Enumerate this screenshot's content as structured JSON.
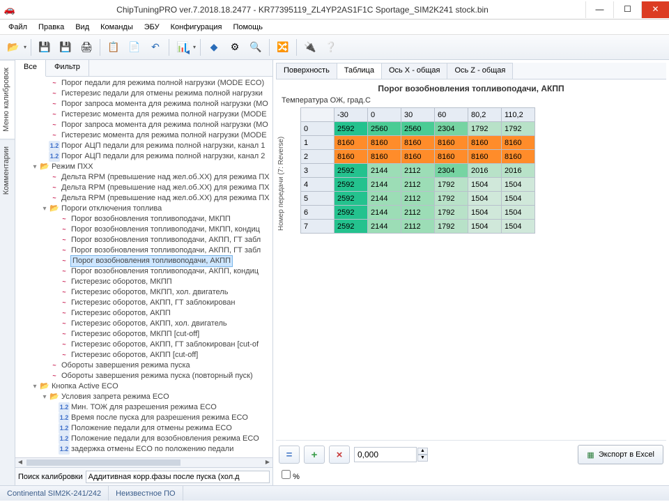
{
  "title": "ChipTuningPRO ver.7.2018.18.2477 - KR77395119_ZL4YP2AS1F1C Sportage_SIM2K241 stock.bin",
  "menu": [
    "Файл",
    "Правка",
    "Вид",
    "Команды",
    "ЭБУ",
    "Конфигурация",
    "Помощь"
  ],
  "vtabs": [
    "Меню калибровок",
    "Комментарии"
  ],
  "lefttabs": [
    "Все",
    "Фильтр"
  ],
  "tree": [
    {
      "d": 2,
      "t": "chart",
      "l": "Порог педали для режима полной нагрузки (MODE ECO)"
    },
    {
      "d": 2,
      "t": "chart",
      "l": "Гистерезис педали для отмены режима полной нагрузки"
    },
    {
      "d": 2,
      "t": "chart",
      "l": "Порог запроса момента для режима полной нагрузки (МО"
    },
    {
      "d": 2,
      "t": "chart",
      "l": "Гистерезис момента для режима полной нагрузки (MODE"
    },
    {
      "d": 2,
      "t": "chart",
      "l": "Порог запроса момента для режима полной нагрузки (МО"
    },
    {
      "d": 2,
      "t": "chart",
      "l": "Гистерезис момента для режима полной нагрузки (MODE"
    },
    {
      "d": 2,
      "t": "scalar",
      "l": "Порог АЦП педали для режима полной нагрузки, канал 1"
    },
    {
      "d": 2,
      "t": "scalar",
      "l": "Порог АЦП педали для режима полной нагрузки, канал 2"
    },
    {
      "d": 1,
      "t": "folder",
      "e": "▾",
      "l": "Режим ПХХ"
    },
    {
      "d": 2,
      "t": "chart",
      "l": "Дельта RPM (превышение над жел.об.ХХ) для режима ПХ"
    },
    {
      "d": 2,
      "t": "chart",
      "l": "Дельта RPM (превышение над жел.об.ХХ) для режима ПХ"
    },
    {
      "d": 2,
      "t": "chart",
      "l": "Дельта RPM (превышение над жел.об.ХХ) для режима ПХ"
    },
    {
      "d": 2,
      "t": "folder",
      "e": "▾",
      "l": "Пороги отключения топлива"
    },
    {
      "d": 3,
      "t": "chart",
      "l": "Порог возобновления топливоподачи, МКПП"
    },
    {
      "d": 3,
      "t": "chart",
      "l": "Порог возобновления топливоподачи, МКПП, кондиц"
    },
    {
      "d": 3,
      "t": "chart",
      "l": "Порог возобновления топливоподачи, АКПП, ГТ забл"
    },
    {
      "d": 3,
      "t": "chart",
      "l": "Порог возобновления топливоподачи, АКПП, ГТ забл"
    },
    {
      "d": 3,
      "t": "chart",
      "l": "Порог возобновления топливоподачи, АКПП",
      "sel": true
    },
    {
      "d": 3,
      "t": "chart",
      "l": "Порог возобновления топливоподачи, АКПП, кондиц"
    },
    {
      "d": 3,
      "t": "chart",
      "l": "Гистерезис оборотов, МКПП"
    },
    {
      "d": 3,
      "t": "chart",
      "l": "Гистерезис оборотов, МКПП, хол. двигатель"
    },
    {
      "d": 3,
      "t": "chart",
      "l": "Гистерезис оборотов, АКПП, ГТ заблокирован"
    },
    {
      "d": 3,
      "t": "chart",
      "l": "Гистерезис оборотов, АКПП"
    },
    {
      "d": 3,
      "t": "chart",
      "l": "Гистерезис оборотов, АКПП, хол. двигатель"
    },
    {
      "d": 3,
      "t": "chart",
      "l": "Гистерезис оборотов, МКПП [cut-off]"
    },
    {
      "d": 3,
      "t": "chart",
      "l": "Гистерезис оборотов, АКПП, ГТ заблокирован [cut-of"
    },
    {
      "d": 3,
      "t": "chart",
      "l": "Гистерезис оборотов, АКПП [cut-off]"
    },
    {
      "d": 2,
      "t": "chart",
      "l": "Обороты завершения режима пуска"
    },
    {
      "d": 2,
      "t": "chart",
      "l": "Обороты завершения режима пуска (повторный пуск)"
    },
    {
      "d": 1,
      "t": "folder",
      "e": "▾",
      "l": "Кнопка Active ECO"
    },
    {
      "d": 2,
      "t": "folder",
      "e": "▾",
      "l": "Условия запрета режима ECO"
    },
    {
      "d": 3,
      "t": "scalar",
      "l": "Мин. ТОЖ для разрешения режима ECO"
    },
    {
      "d": 3,
      "t": "scalar",
      "l": "Время после пуска для разрешения режима ECO"
    },
    {
      "d": 3,
      "t": "scalar",
      "l": "Положение педали для отмены режима ECO"
    },
    {
      "d": 3,
      "t": "scalar",
      "l": "Положение педали для возобновления режима ECO"
    },
    {
      "d": 3,
      "t": "scalar",
      "l": "задержка отмены ECO по положению педали"
    }
  ],
  "search_label": "Поиск калибровки",
  "search_value": "Аддитивная корр.фазы после пуска (хол.д",
  "righttabs": [
    "Поверхность",
    "Таблица",
    "Ось X - общая",
    "Ось Z - общая"
  ],
  "active_righttab": 1,
  "table_title": "Порог возобновления топливоподачи, АКПП",
  "xlabel": "Температура ОЖ, град.С",
  "ylabel": "Номер передачи (7: Reverse)",
  "chart_data": {
    "type": "table",
    "x": [
      "-30",
      "0",
      "30",
      "60",
      "80,2",
      "110,2"
    ],
    "y": [
      "0",
      "1",
      "2",
      "3",
      "4",
      "5",
      "6",
      "7"
    ],
    "rows": [
      [
        2592,
        2560,
        2560,
        2304,
        1792,
        1792
      ],
      [
        8160,
        8160,
        8160,
        8160,
        8160,
        8160
      ],
      [
        8160,
        8160,
        8160,
        8160,
        8160,
        8160
      ],
      [
        2592,
        2144,
        2112,
        2304,
        2016,
        2016
      ],
      [
        2592,
        2144,
        2112,
        1792,
        1504,
        1504
      ],
      [
        2592,
        2144,
        2112,
        1792,
        1504,
        1504
      ],
      [
        2592,
        2144,
        2112,
        1792,
        1504,
        1504
      ],
      [
        2592,
        2144,
        2112,
        1792,
        1504,
        1504
      ]
    ],
    "colors": [
      [
        "c0",
        "c1",
        "c1",
        "c2",
        "c5",
        "c5"
      ],
      [
        "c3",
        "c3",
        "c3",
        "c3",
        "c3",
        "c3"
      ],
      [
        "c3",
        "c3",
        "c3",
        "c3",
        "c3",
        "c3"
      ],
      [
        "c0",
        "c4",
        "c4",
        "c2",
        "c5",
        "c5"
      ],
      [
        "c0",
        "c4",
        "c4",
        "c5",
        "c6",
        "c6"
      ],
      [
        "c0",
        "c4",
        "c4",
        "c5",
        "c6",
        "c6"
      ],
      [
        "c0",
        "c4",
        "c4",
        "c5",
        "c6",
        "c6"
      ],
      [
        "c0",
        "c4",
        "c4",
        "c5",
        "c6",
        "c6"
      ]
    ]
  },
  "ctrl": {
    "eq": "=",
    "plus": "+",
    "times": "×",
    "value": "0,000",
    "pct": "%"
  },
  "export_label": "Экспорт в Excel",
  "status": [
    "Continental SIM2K-241/242",
    "Неизвестное ПО"
  ]
}
